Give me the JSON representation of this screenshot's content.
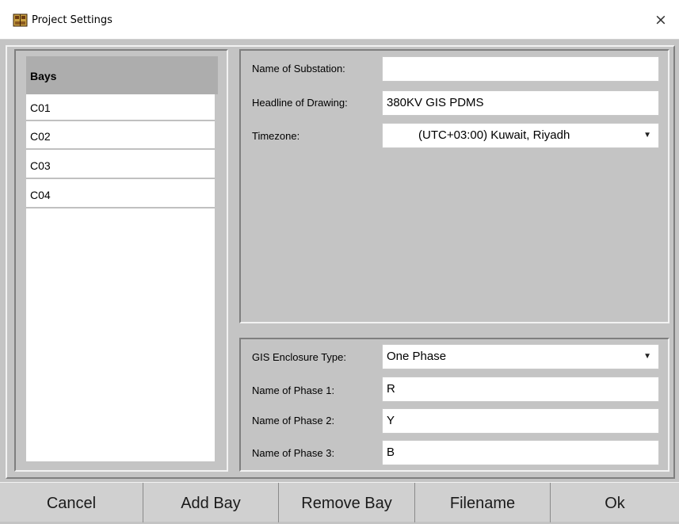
{
  "window": {
    "title": "Project Settings",
    "close_glyph": "×",
    "app_icon": "app-logo-icon",
    "close_icon": "close-icon"
  },
  "bays": {
    "header": "Bays",
    "items": [
      {
        "label": "C01"
      },
      {
        "label": "C02"
      },
      {
        "label": "C03"
      },
      {
        "label": "C04"
      }
    ]
  },
  "project": {
    "substation_label": "Name of Substation:",
    "substation_value": "",
    "headline_label": "Headline of Drawing:",
    "headline_value": "380KV GIS PDMS",
    "timezone_label": "Timezone:",
    "timezone_value": "(UTC+03:00) Kuwait, Riyadh"
  },
  "gis": {
    "enclosure_label": "GIS Enclosure Type:",
    "enclosure_value": "One Phase",
    "phase1_label": "Name of Phase 1:",
    "phase1_value": "R",
    "phase2_label": "Name of Phase 2:",
    "phase2_value": "Y",
    "phase3_label": "Name of Phase 3:",
    "phase3_value": "B"
  },
  "dropdown_arrow": "▼",
  "buttons": {
    "cancel": "Cancel",
    "add_bay": "Add Bay",
    "remove_bay": "Remove Bay",
    "filename": "Filename",
    "ok": "Ok"
  },
  "colors": {
    "panel_bg": "#c4c4c4",
    "list_header_bg": "#adadad",
    "button_bar_bg": "#d0d0d0"
  }
}
